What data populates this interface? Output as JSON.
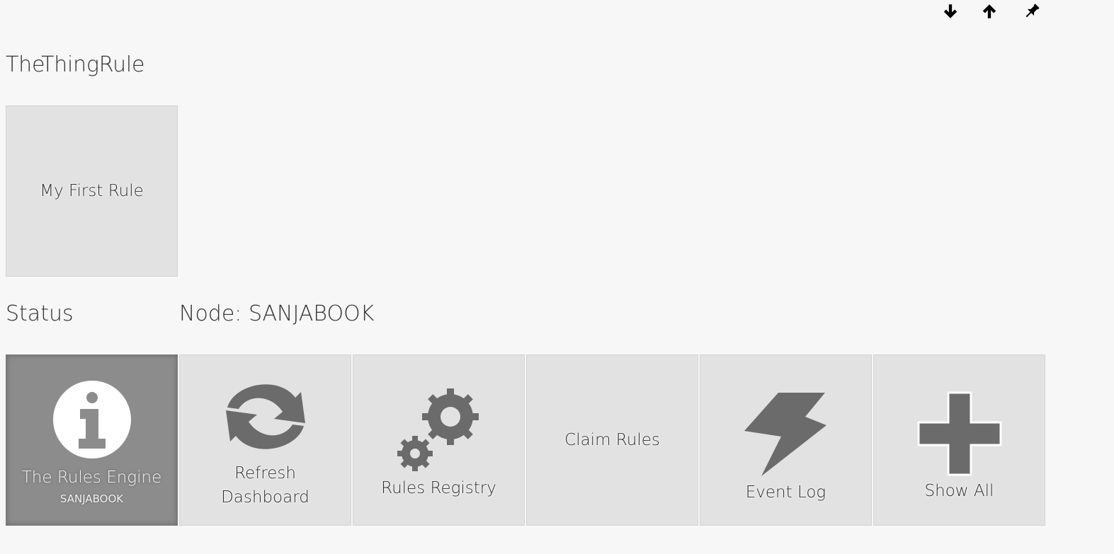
{
  "toolbar": {
    "move_down_icon": "arrow-down-icon",
    "move_up_icon": "arrow-up-icon",
    "pin_icon": "pin-icon"
  },
  "page": {
    "title": "TheThingRule"
  },
  "rules": [
    {
      "label": "My First Rule"
    }
  ],
  "status": {
    "label": "Status",
    "node": "Node: SANJABOOK"
  },
  "actions": [
    {
      "label": "The Rules Engine",
      "sub": "SANJABOOK",
      "icon": "info-icon"
    },
    {
      "label": "Refresh Dashboard",
      "icon": "refresh-icon"
    },
    {
      "label": "Rules Registry",
      "icon": "gears-icon"
    },
    {
      "label": "Claim Rules"
    },
    {
      "label": "Event Log",
      "icon": "lightning-icon"
    },
    {
      "label": "Show All",
      "icon": "plus-icon"
    }
  ],
  "colors": {
    "background": "#f7f7f7",
    "tile": "#e2e2e2",
    "tile_active": "#8c8c8c",
    "icon": "#6b6b6b"
  }
}
